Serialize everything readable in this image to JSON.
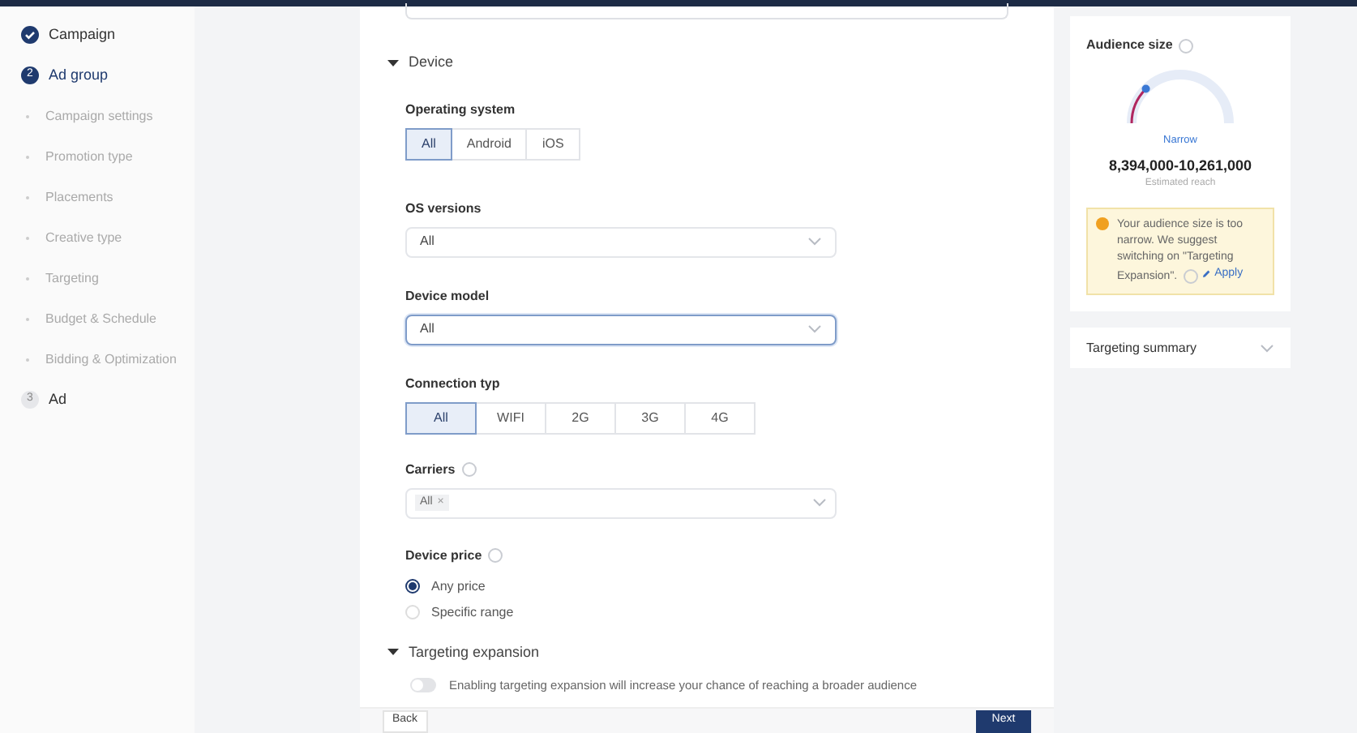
{
  "steps": [
    {
      "label": "Campaign",
      "completed": true,
      "current": false
    },
    {
      "label": "Ad group",
      "completed": false,
      "current": true,
      "number": "2",
      "children": [
        {
          "label": "Campaign settings"
        },
        {
          "label": "Promotion type"
        },
        {
          "label": "Placements"
        },
        {
          "label": "Creative type"
        },
        {
          "label": "Targeting"
        },
        {
          "label": "Budget & Schedule"
        },
        {
          "label": "Bidding & Optimization"
        }
      ]
    },
    {
      "label": "Ad",
      "completed": false,
      "current": false,
      "number": "3"
    }
  ],
  "device": {
    "title": "Device",
    "expanded": true,
    "operating_system": {
      "label": "Operating system",
      "options": [
        {
          "label": "All",
          "selected": true
        },
        {
          "label": "Android",
          "selected": false
        },
        {
          "label": "iOS",
          "selected": false
        }
      ]
    },
    "os_versions": {
      "label": "OS versions",
      "value": "All"
    },
    "device_model": {
      "label": "Device model",
      "value": "All",
      "focused": true
    },
    "connection_type": {
      "label": "Connection typ",
      "options": [
        {
          "label": "All",
          "selected": true
        },
        {
          "label": "WIFI",
          "selected": false
        },
        {
          "label": "2G",
          "selected": false
        },
        {
          "label": "3G",
          "selected": false
        },
        {
          "label": "4G",
          "selected": false
        }
      ]
    },
    "carriers": {
      "label": "Carriers",
      "tags": [
        "All"
      ],
      "tag_remove": "×"
    },
    "device_price": {
      "label": "Device price",
      "options": [
        {
          "label": "Any price",
          "selected": true
        },
        {
          "label": "Specific range",
          "selected": false
        }
      ]
    }
  },
  "targeting_expansion": {
    "title": "Targeting expansion",
    "expanded": true,
    "on": false,
    "text": "Enabling targeting expansion will increase your chance of reaching a broader audience"
  },
  "footer": {
    "back": "Back",
    "next": "Next"
  },
  "audience": {
    "title": "Audience size",
    "level": 0.25,
    "gauge_label": "Narrow",
    "reach": "8,394,000-10,261,000",
    "reach_caption": "Estimated reach",
    "warning": "Your audience size is too narrow. We suggest switching on \"Targeting Expansion\".",
    "apply": "Apply"
  },
  "summary": {
    "title": "Targeting summary",
    "expanded": false
  }
}
